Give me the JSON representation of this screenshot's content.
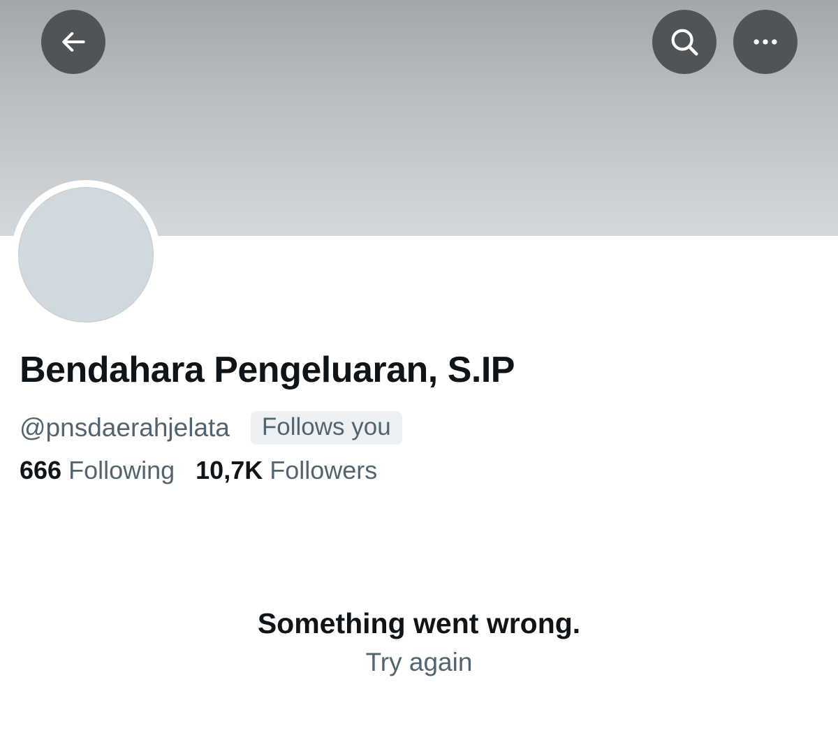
{
  "header": {
    "back_icon": "arrow-left-icon",
    "search_icon": "search-icon",
    "more_icon": "more-horizontal-icon",
    "button_color": "#505457",
    "banner_colors": [
      "#a3a7aa",
      "#d3d8dc"
    ]
  },
  "profile": {
    "display_name": "Bendahara Pengeluaran, S.IP",
    "handle": "@pnsdaerahjelata",
    "follows_you_badge": "Follows you",
    "following_count": "666",
    "following_label": "Following",
    "followers_count": "10,7K",
    "followers_label": "Followers"
  },
  "error": {
    "message": "Something went wrong.",
    "retry_label": "Try again"
  }
}
